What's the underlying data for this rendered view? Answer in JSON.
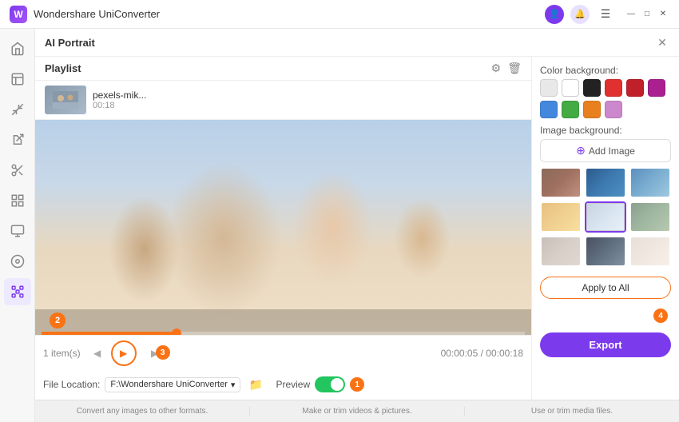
{
  "app": {
    "title": "Wondershare UniConverter",
    "logo_color": "#7c3aed"
  },
  "title_bar": {
    "title": "Wondershare UniConverter",
    "minimize": "—",
    "maximize": "□",
    "close": "✕"
  },
  "panel": {
    "title": "AI Portrait",
    "close": "✕"
  },
  "playlist": {
    "title": "Playlist",
    "item_name": "pexels-mik...",
    "item_duration": "00:18"
  },
  "video_controls": {
    "items_count": "1 item(s)",
    "time": "00:00:05 / 00:00:18",
    "step2": "2",
    "step3": "3",
    "step4": "4"
  },
  "file_location": {
    "label": "File Location:",
    "path": "F:\\Wondershare UniConverter"
  },
  "preview": {
    "label": "Preview"
  },
  "step1": "1",
  "right_panel": {
    "color_bg_label": "Color background:",
    "colors": [
      {
        "color": "#e8e8e8",
        "name": "light-gray"
      },
      {
        "color": "#ffffff",
        "name": "white"
      },
      {
        "color": "#222222",
        "name": "black"
      },
      {
        "color": "#e03030",
        "name": "red"
      },
      {
        "color": "#c0202a",
        "name": "dark-red"
      },
      {
        "color": "#aa2090",
        "name": "purple-red"
      },
      {
        "color": "#4488dd",
        "name": "blue"
      },
      {
        "color": "#44aa44",
        "name": "green"
      },
      {
        "color": "#e88020",
        "name": "orange"
      },
      {
        "color": "#cc88cc",
        "name": "lavender"
      }
    ],
    "image_bg_label": "Image background:",
    "add_image_label": "Add Image",
    "apply_all_label": "Apply to All",
    "export_label": "Export"
  },
  "footer": {
    "info1": "Convert any images to other formats.",
    "info2": "Make or trim videos & pictures.",
    "info3": "Use or trim media files."
  }
}
